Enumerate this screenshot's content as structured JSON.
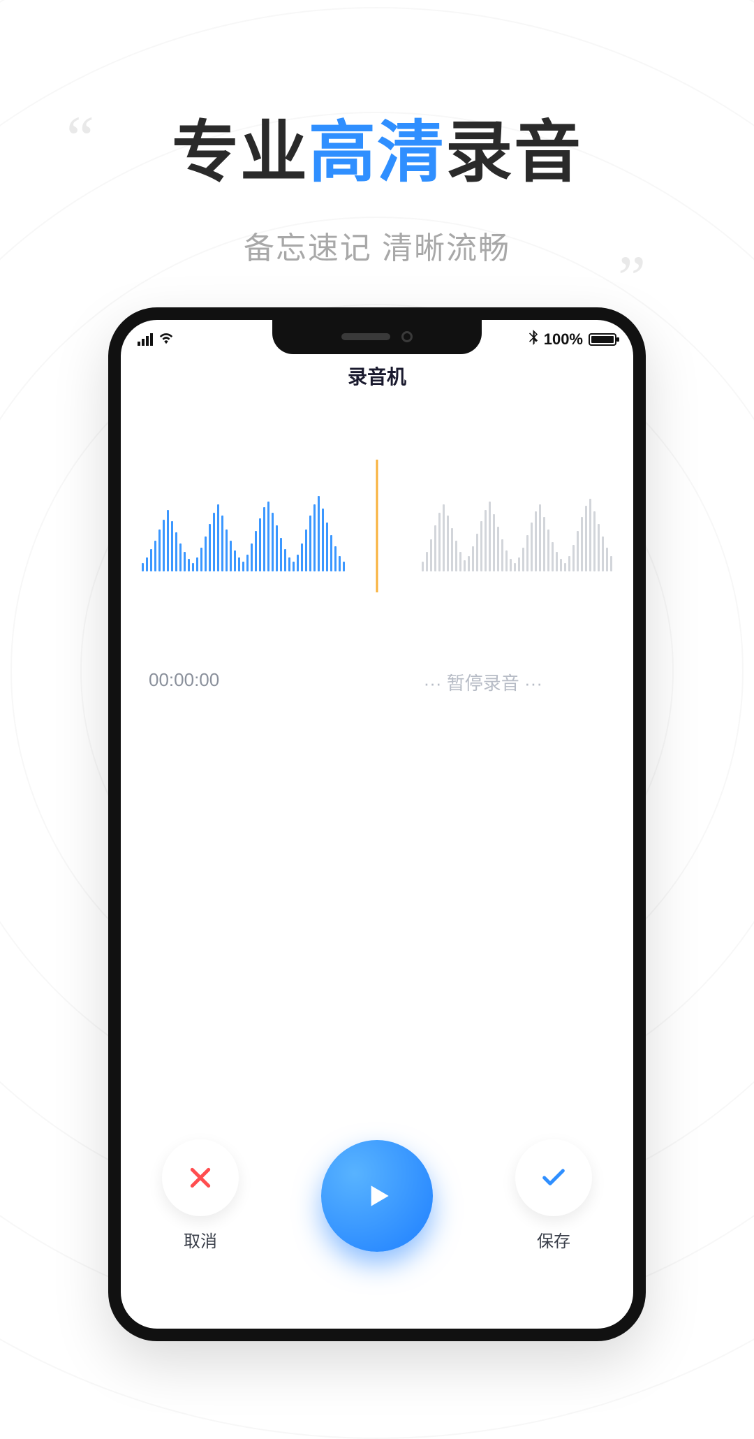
{
  "promo": {
    "title_pre": "专业",
    "title_hl": "高清",
    "title_post": "录音",
    "subtitle": "备忘速记  清晰流畅"
  },
  "status": {
    "bluetooth_icon": "bluetooth",
    "battery_text": "100%"
  },
  "app": {
    "title": "录音机",
    "elapsed": "00:00:00",
    "status_text": "···  暂停录音  ···"
  },
  "controls": {
    "cancel_label": "取消",
    "save_label": "保存"
  },
  "colors": {
    "accent_blue": "#2f8fff",
    "waveform_active": "#3b97ff",
    "waveform_inactive": "#d2d5da",
    "playhead": "#f8b23c"
  },
  "waveform": {
    "left_heights": [
      12,
      20,
      32,
      44,
      60,
      74,
      88,
      72,
      56,
      40,
      28,
      18,
      12,
      20,
      34,
      50,
      68,
      84,
      96,
      80,
      60,
      44,
      30,
      20,
      14,
      24,
      40,
      58,
      76,
      92,
      100,
      84,
      66,
      48,
      32,
      20,
      14,
      24,
      40,
      60,
      80,
      96,
      108,
      90,
      70,
      52,
      36,
      22,
      14
    ],
    "right_heights": [
      14,
      28,
      46,
      66,
      84,
      96,
      80,
      62,
      44,
      28,
      16,
      22,
      36,
      54,
      72,
      88,
      100,
      82,
      64,
      46,
      30,
      18,
      12,
      20,
      34,
      52,
      70,
      86,
      96,
      78,
      60,
      42,
      28,
      18,
      12,
      22,
      38,
      58,
      78,
      94,
      104,
      86,
      68,
      50,
      34,
      22
    ]
  }
}
